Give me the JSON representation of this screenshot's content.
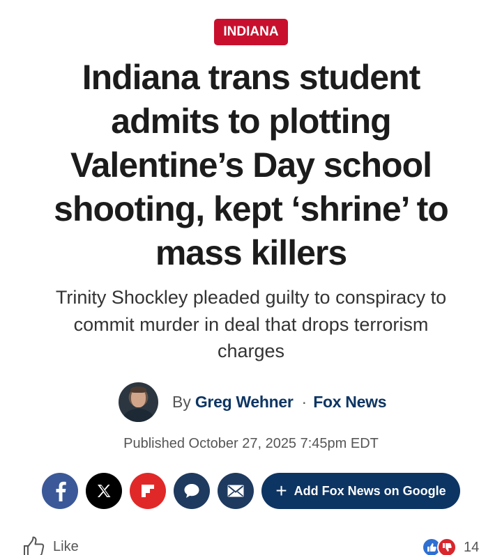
{
  "article": {
    "category": "INDIANA",
    "headline": "Indiana trans student admits to plotting Valentine’s Day school shooting, kept ‘shrine’ to mass killers",
    "subheadline": "Trinity Shockley pleaded guilty to conspiracy to commit murder in deal that drops terrorism charges",
    "byline": {
      "by_prefix": "By",
      "author": "Greg Wehner",
      "separator": "·",
      "outlet": "Fox News"
    },
    "published": "Published October 27, 2025 7:45pm EDT"
  },
  "share": {
    "icons": [
      "facebook-icon",
      "x-icon",
      "flipboard-icon",
      "comment-icon",
      "email-icon"
    ],
    "google_button_label": "Add Fox News on Google",
    "google_button_prefix": "+"
  },
  "engagement": {
    "like_label": "Like",
    "reaction_count": "14"
  },
  "colors": {
    "category_red": "#c8102e",
    "navy": "#0d3563",
    "facebook": "#3b5998",
    "flipboard": "#e12828"
  }
}
